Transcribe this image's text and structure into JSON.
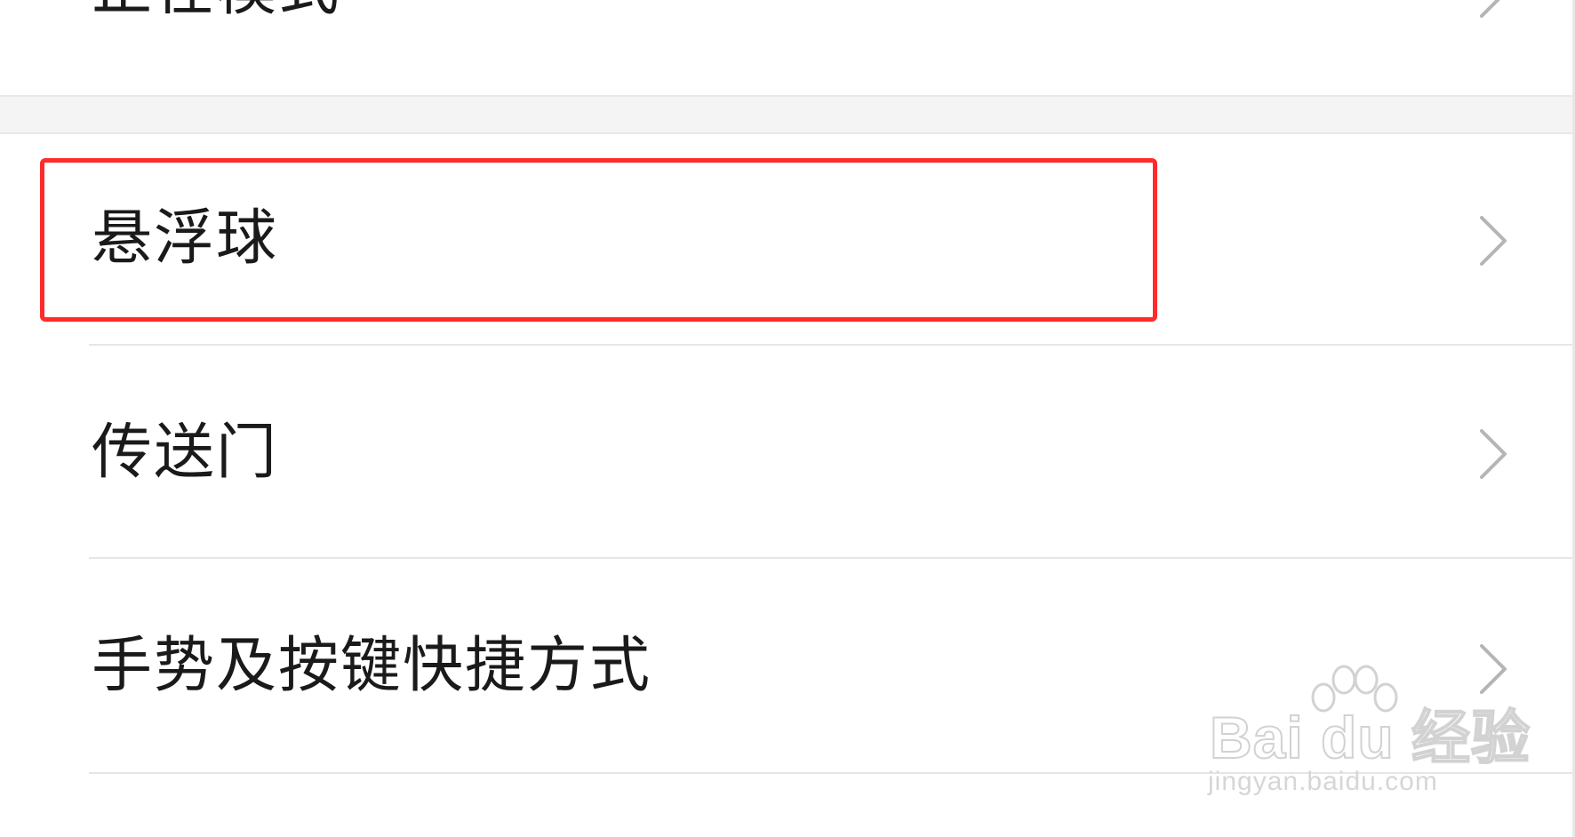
{
  "settings_list": {
    "partial_top_item": {
      "label": "正在模式"
    },
    "items": [
      {
        "label": "悬浮球"
      },
      {
        "label": "传送门"
      },
      {
        "label": "手势及按键快捷方式"
      }
    ]
  },
  "highlight": {
    "target": "悬浮球",
    "color": "#ff2b2b"
  },
  "watermark": {
    "logo_text": "Bai du 经验",
    "url": "jingyan.baidu.com"
  },
  "icons": {
    "row_chevron": "chevron-right-icon"
  }
}
